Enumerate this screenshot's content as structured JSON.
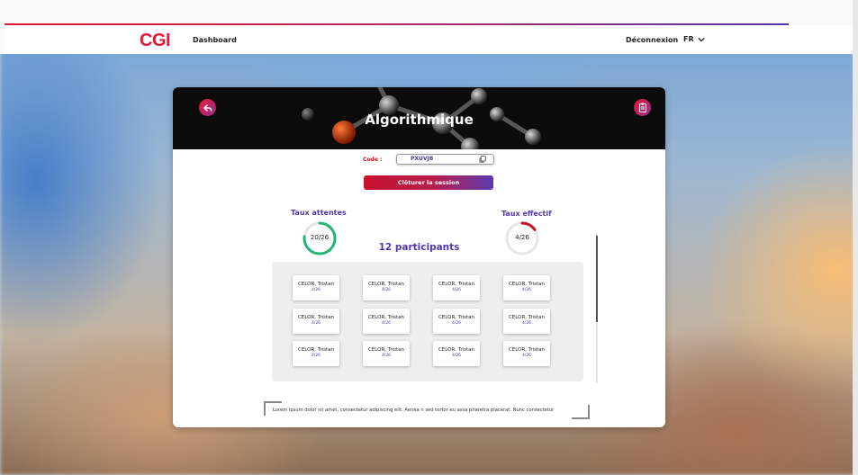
{
  "header": {
    "logo": "CGI",
    "nav_dashboard": "Dashboard",
    "logout": "Déconnexion",
    "language": "FR"
  },
  "colors": {
    "brand_red": "#e31937",
    "brand_purple": "#5236ab",
    "ring_attendance": "#22b573",
    "ring_effective": "#c8102e"
  },
  "icons": {
    "back": "back-arrow-icon",
    "clipboard": "clipboard-icon",
    "copy": "copy-icon",
    "language": "chevron-down-icon"
  },
  "session": {
    "title": "Algorithmique",
    "code_label": "Code :",
    "code_value": "PXUVJB",
    "close_button": "Clôturer la session"
  },
  "stats": {
    "attendance": {
      "label": "Taux attentes",
      "value": "20/26",
      "fraction": 0.769
    },
    "effective": {
      "label": "Taux effectif",
      "value": "4/26",
      "fraction": 0.154
    },
    "participants": "12 participants"
  },
  "participants": [
    {
      "name": "CELOR, Tristan",
      "score": "4/26"
    },
    {
      "name": "CELOR, Tristan",
      "score": "4/26"
    },
    {
      "name": "CELOR, Tristan",
      "score": "4/26"
    },
    {
      "name": "CELOR, Tristan",
      "score": "4/26"
    },
    {
      "name": "CELOR, Tristan",
      "score": "4/26"
    },
    {
      "name": "CELOR, Tristan",
      "score": "4/26"
    },
    {
      "name": "CELOR, Tristan",
      "score": "4/26"
    },
    {
      "name": "CELOR, Tristan",
      "score": "4/26"
    },
    {
      "name": "CELOR, Tristan",
      "score": "4/26"
    },
    {
      "name": "CELOR, Tristan",
      "score": "4/26"
    },
    {
      "name": "CELOR, Tristan",
      "score": "4/26"
    },
    {
      "name": "CELOR, Tristan",
      "score": "4/26"
    }
  ],
  "quote": "Lorem ipsum dolor sit amet, consectetur adipiscing elit. Aenea n sed tortor eu assa pharetra placerat. Nunc consectetur"
}
